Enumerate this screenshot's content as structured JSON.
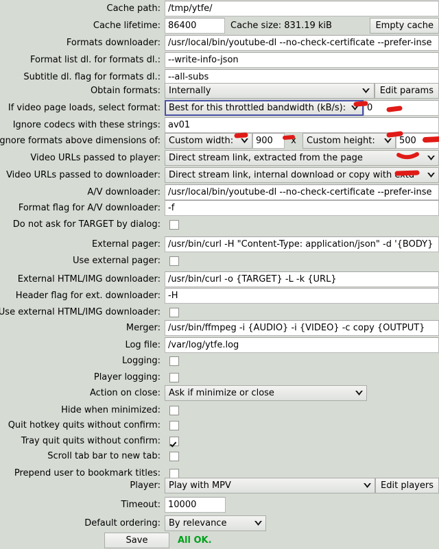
{
  "window": {
    "background_color": "#d6dbd4",
    "status_ok_color": "#00a11b",
    "focus_border_color": "#4a52a8",
    "annotation_color": "#e01b17"
  },
  "rows": [
    {
      "label": "Cache path:",
      "type": "entry",
      "value": "/tmp/ytfe/"
    },
    {
      "label": "Cache lifetime:",
      "type": "entry-info-button",
      "value": "86400",
      "info": "Cache size: 831.19 kiB",
      "button": "Empty cache"
    },
    {
      "label": "Formats downloader:",
      "type": "entry",
      "value": "/usr/local/bin/youtube-dl --no-check-certificate --prefer-inse"
    },
    {
      "label": "Format list dl. for formats dl.:",
      "type": "entry",
      "value": "--write-info-json"
    },
    {
      "label": "Subtitle dl. flag for formats dl.:",
      "type": "entry",
      "value": "--all-subs"
    },
    {
      "label": "Obtain formats:",
      "type": "combo-button",
      "value": "Internally",
      "button": "Edit params"
    },
    {
      "label": "If video page loads, select format:",
      "type": "combo-focused-entry",
      "value": "Best for this throttled bandwidth (kB/s):",
      "entry_value": "0"
    },
    {
      "label": "Ignore codecs with these strings:",
      "type": "entry",
      "value": "av01"
    },
    {
      "label": "Ignore formats above dimensions of:",
      "type": "dimensions",
      "width_combo": "Custom width:",
      "width_value": "900",
      "separator": "x",
      "height_combo": "Custom height:",
      "height_value": "500"
    },
    {
      "label": "Video URLs passed to player:",
      "type": "combo",
      "value": "Direct stream link, extracted from the page"
    },
    {
      "label": "Video URLs passed to downloader:",
      "type": "combo",
      "value": "Direct stream link, internal download or copy with extd"
    },
    {
      "label": "A/V downloader:",
      "type": "entry",
      "value": "/usr/local/bin/youtube-dl --no-check-certificate --prefer-inse"
    },
    {
      "label": "Format flag for A/V downloader:",
      "type": "entry",
      "value": "-f"
    },
    {
      "label": "Do not ask for TARGET by dialog:",
      "type": "checkbox",
      "checked": false
    },
    {
      "label": "External pager:",
      "type": "entry",
      "value": "/usr/bin/curl -H \"Content-Type: application/json\" -d '{BODY}"
    },
    {
      "label": "Use external pager:",
      "type": "checkbox",
      "checked": false
    },
    {
      "label": "External HTML/IMG downloader:",
      "type": "entry",
      "value": "/usr/bin/curl -o {TARGET} -L -k {URL}"
    },
    {
      "label": "Header flag for ext. downloader:",
      "type": "entry",
      "value": "-H"
    },
    {
      "label": "Use external HTML/IMG downloader:",
      "type": "checkbox",
      "checked": false
    },
    {
      "label": "Merger:",
      "type": "entry",
      "value": "/usr/bin/ffmpeg -i {AUDIO} -i {VIDEO} -c copy {OUTPUT}"
    },
    {
      "label": "Log file:",
      "type": "entry",
      "value": "/var/log/ytfe.log"
    },
    {
      "label": "Logging:",
      "type": "checkbox",
      "checked": false
    },
    {
      "label": "Player logging:",
      "type": "checkbox",
      "checked": false
    },
    {
      "label": "Action on close:",
      "type": "combo-narrow",
      "value": "Ask if minimize or close"
    },
    {
      "label": "Hide when minimized:",
      "type": "checkbox",
      "checked": false
    },
    {
      "label": "Quit hotkey quits without confirm:",
      "type": "checkbox",
      "checked": false
    },
    {
      "label": "Tray quit quits without confirm:",
      "type": "checkbox",
      "checked": true
    },
    {
      "label": "Scroll tab bar to new tab:",
      "type": "checkbox",
      "checked": false
    },
    {
      "label": "Prepend user to bookmark titles:",
      "type": "checkbox",
      "checked": false
    },
    {
      "label": "Player:",
      "type": "combo-button",
      "value": "Play with MPV",
      "button": "Edit players"
    },
    {
      "label": "Timeout:",
      "type": "entry-small",
      "value": "10000"
    },
    {
      "label": "Default ordering:",
      "type": "combo-small",
      "value": "By relevance"
    },
    {
      "label": "",
      "type": "save",
      "button": "Save",
      "status": "All OK."
    }
  ]
}
